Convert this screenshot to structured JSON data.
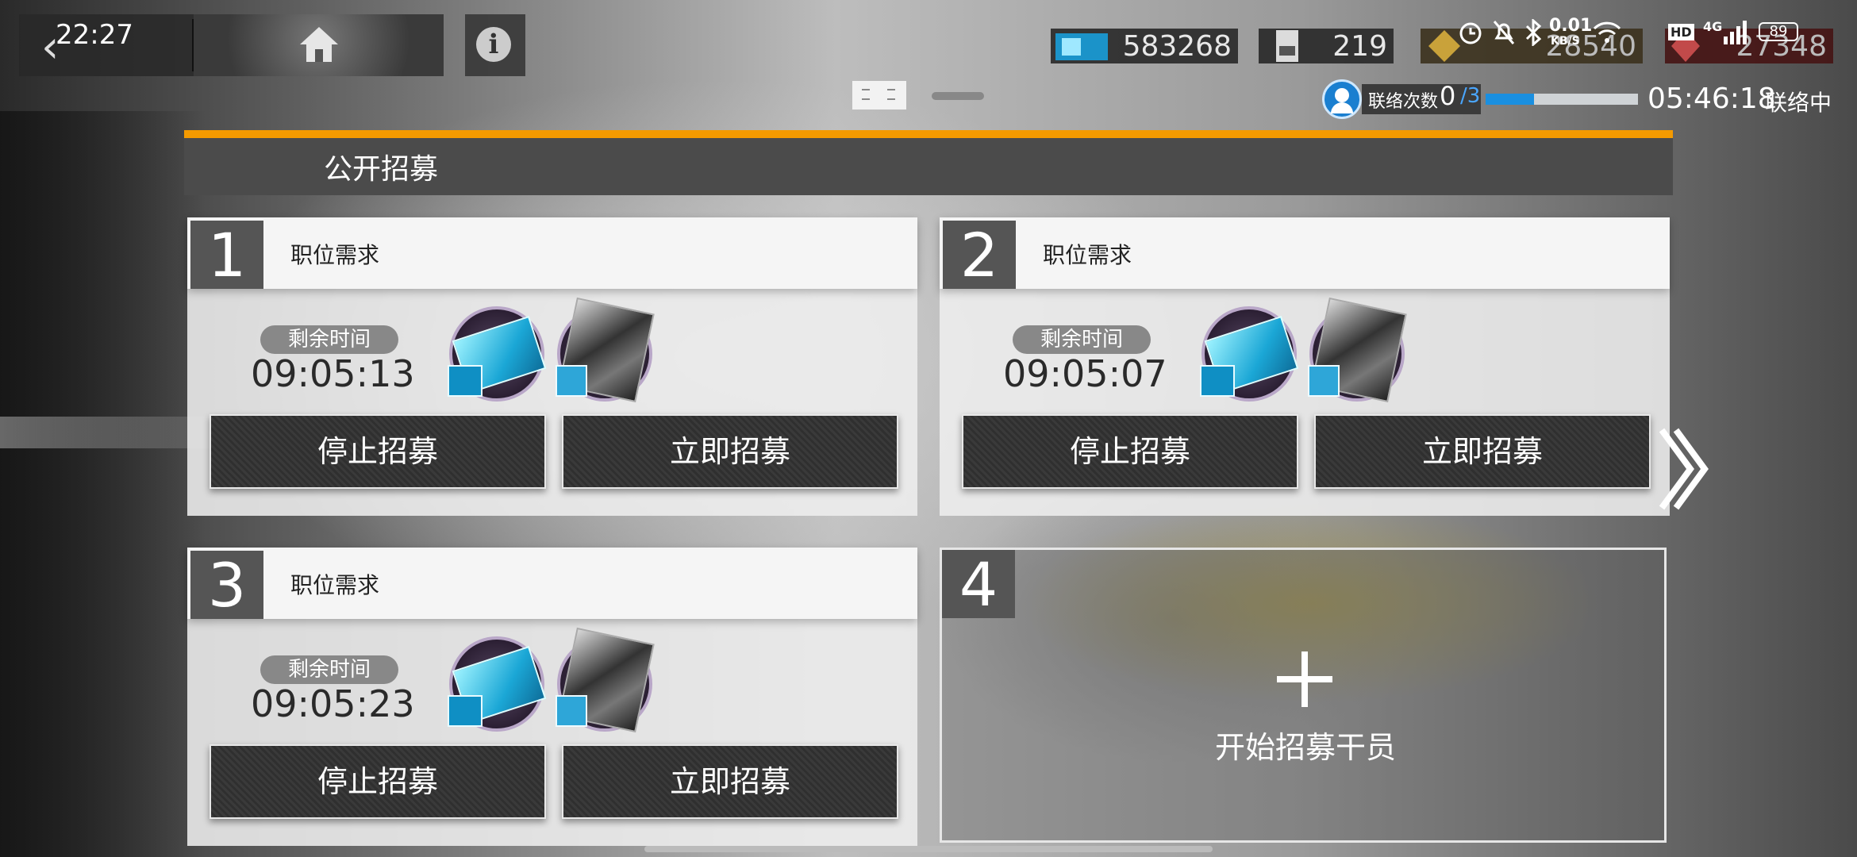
{
  "status_bar": {
    "time": "22:27",
    "net_speed": "0.01",
    "net_unit": "KB/S",
    "hd": "HD",
    "network": "4G",
    "battery": "89"
  },
  "resources": [
    {
      "name": "recruitment-permit",
      "value": "583268"
    },
    {
      "name": "expedited-plan",
      "value": "219"
    },
    {
      "name": "lmd",
      "value": "28540"
    },
    {
      "name": "originite",
      "value": "27348"
    }
  ],
  "contact": {
    "label": "联络次数",
    "count": "0",
    "total": "/3",
    "progress": 0.32,
    "timer": "05:46:18",
    "status": "联络中"
  },
  "section": {
    "title": "公开招募"
  },
  "slots": [
    {
      "number": "1",
      "label": "职位需求",
      "timer_label": "剩余时间",
      "timer": "09:05:13",
      "stop": "停止招募",
      "now": "立即招募"
    },
    {
      "number": "2",
      "label": "职位需求",
      "timer_label": "剩余时间",
      "timer": "09:05:07",
      "stop": "停止招募",
      "now": "立即招募"
    },
    {
      "number": "3",
      "label": "职位需求",
      "timer_label": "剩余时间",
      "timer": "09:05:23",
      "stop": "停止招募",
      "now": "立即招募"
    }
  ],
  "slot4": {
    "number": "4",
    "label": "开始招募干员"
  },
  "colors": {
    "accent": "#f49a00",
    "contact_blue": "#1a8fe0"
  }
}
